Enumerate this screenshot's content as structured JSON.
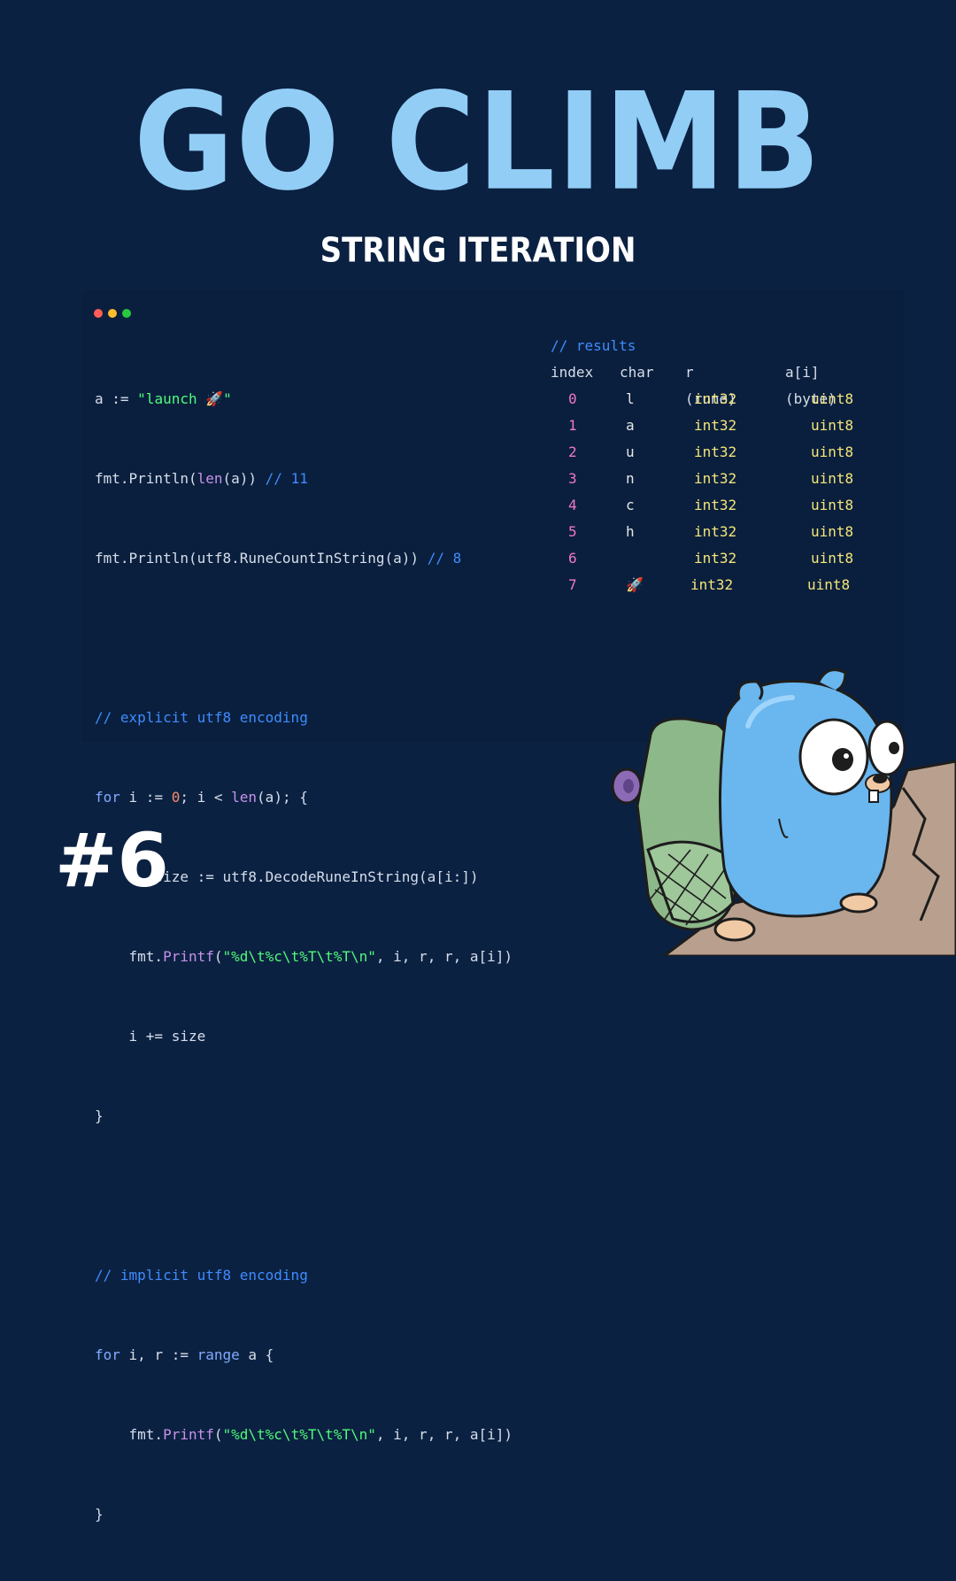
{
  "title": "GO CLIMB",
  "subtitle": "STRING ITERATION",
  "badge": "#6",
  "colors": {
    "background": "#0b2141",
    "title": "#92cdf6",
    "comment": "#3f8cff",
    "string": "#50fa7b",
    "function": "#c792ea",
    "index_value": "#f078c8",
    "type_value": "#f5e57a"
  },
  "code": {
    "l1": {
      "a": "a := ",
      "b": "\"launch 🚀\""
    },
    "l2": {
      "a": "fmt.Println(",
      "fn": "len",
      "b": "(a)) ",
      "cm": "// 11"
    },
    "l3": {
      "a": "fmt.Println(utf8.RuneCountInString(a)) ",
      "cm": "// 8"
    },
    "l5": {
      "cm": "// explicit utf8 encoding"
    },
    "l6": {
      "kw": "for",
      "a": " i := ",
      "num": "0",
      "b": "; i < ",
      "fn": "len",
      "c": "(a); {"
    },
    "l7": {
      "a": "    r, size := utf8.DecodeRuneInString(a[i:])"
    },
    "l8": {
      "a": "    fmt.",
      "fn": "Printf",
      "b": "(",
      "str": "\"%d\\t%c\\t%T\\t%T\\n\"",
      "c": ", i, r, r, a[i])"
    },
    "l9": {
      "a": "    i += size"
    },
    "l10": {
      "a": "}"
    },
    "l12": {
      "cm": "// implicit utf8 encoding"
    },
    "l13": {
      "kw": "for",
      "a": " i, r := ",
      "kw2": "range",
      "b": " a {"
    },
    "l14": {
      "a": "    fmt.",
      "fn": "Printf",
      "b": "(",
      "str": "\"%d\\t%c\\t%T\\t%T\\n\"",
      "c": ", i, r, r, a[i])"
    },
    "l15": {
      "a": "}"
    }
  },
  "results": {
    "comment": "// results",
    "headers": {
      "index": "index",
      "char": "char",
      "rune": "r (rune)",
      "byte": "a[i] (byte)"
    },
    "rows": [
      {
        "index": "0",
        "char": "l",
        "rune": "int32",
        "byte": "uint8"
      },
      {
        "index": "1",
        "char": "a",
        "rune": "int32",
        "byte": "uint8"
      },
      {
        "index": "2",
        "char": "u",
        "rune": "int32",
        "byte": "uint8"
      },
      {
        "index": "3",
        "char": "n",
        "rune": "int32",
        "byte": "uint8"
      },
      {
        "index": "4",
        "char": "c",
        "rune": "int32",
        "byte": "uint8"
      },
      {
        "index": "5",
        "char": "h",
        "rune": "int32",
        "byte": "uint8"
      },
      {
        "index": "6",
        "char": "",
        "rune": "int32",
        "byte": "uint8"
      },
      {
        "index": "7",
        "char": "🚀",
        "rune": "int32",
        "byte": "uint8"
      }
    ]
  }
}
